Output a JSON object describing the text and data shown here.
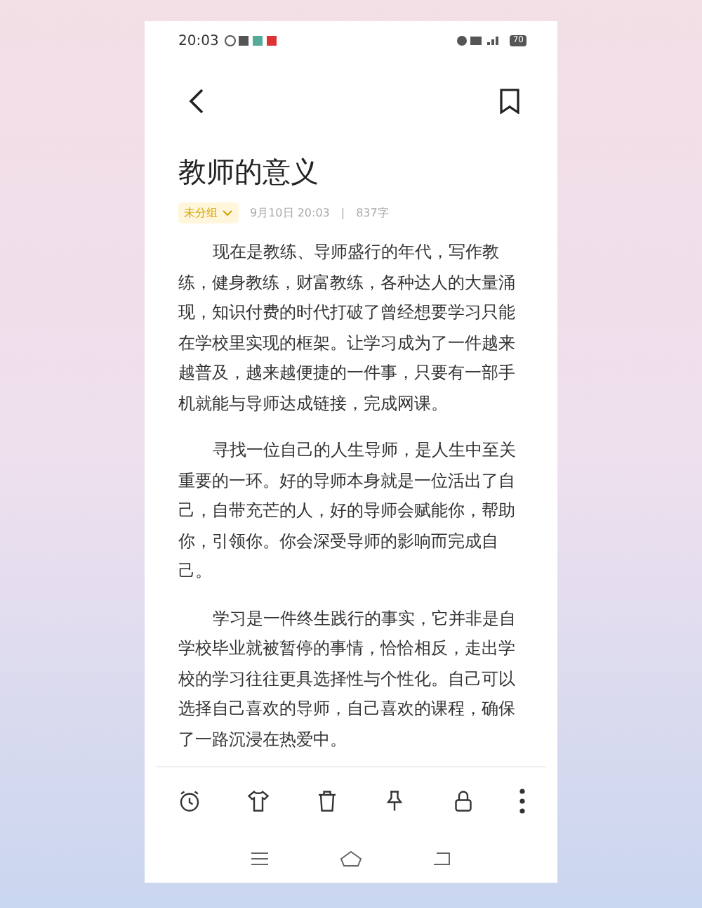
{
  "status_bar": {
    "time": "20:03",
    "battery": "70"
  },
  "note": {
    "title": "教师的意义",
    "category": "未分组",
    "date": "9月10日 20:03",
    "separator": "|",
    "word_count": "837字",
    "paragraphs": [
      "现在是教练、导师盛行的年代，写作教练，健身教练，财富教练，各种达人的大量涌现，知识付费的时代打破了曾经想要学习只能在学校里实现的框架。让学习成为了一件越来越普及，越来越便捷的一件事，只要有一部手机就能与导师达成链接，完成网课。",
      "寻找一位自己的人生导师，是人生中至关重要的一环。好的导师本身就是一位活出了自己，自带充芒的人，好的导师会赋能你，帮助你，引领你。你会深受导师的影响而完成自己。",
      "学习是一件终生践行的事实，它并非是自学校毕业就被暂停的事情，恰恰相反，走出学校的学习往往更具选择性与个性化。自己可以选择自己喜欢的导师，自己喜欢的课程，确保了一路沉浸在热爱中。"
    ]
  },
  "toolbar": [
    {
      "kind": "alarm"
    },
    {
      "kind": "shirt"
    },
    {
      "kind": "trash"
    },
    {
      "kind": "pin"
    },
    {
      "kind": "lock"
    },
    {
      "kind": "more"
    }
  ]
}
